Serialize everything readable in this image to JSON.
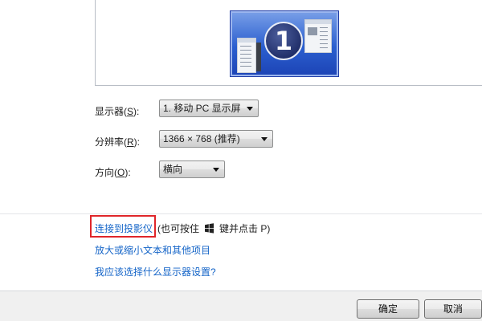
{
  "preview": {
    "monitor_number": "1"
  },
  "settings": {
    "display": {
      "label_text": "显示器(",
      "label_key": "S",
      "label_end": "):",
      "value": "1. 移动 PC 显示屏"
    },
    "resolution": {
      "label_text": "分辨率(",
      "label_key": "R",
      "label_end": "):",
      "value": "1366 × 768 (推荐)"
    },
    "orientation": {
      "label_text": "方向(",
      "label_key": "O",
      "label_end": "):",
      "value": "横向"
    }
  },
  "links": {
    "connect_projector": "连接到投影仪",
    "shortcut_hint_prefix": "(也可按住",
    "shortcut_hint_suffix": "键并点击 P)",
    "text_size": "放大或缩小文本和其他项目",
    "which_settings": "我应该选择什么显示器设置?"
  },
  "buttons": {
    "ok": "确定",
    "cancel": "取消"
  },
  "icons": {
    "windows_key": "windows-logo-icon",
    "dropdown": "dropdown-arrow-icon"
  },
  "colors": {
    "link": "#1565c8",
    "highlight": "#e0262a",
    "monitor": "#2b5fcf"
  }
}
